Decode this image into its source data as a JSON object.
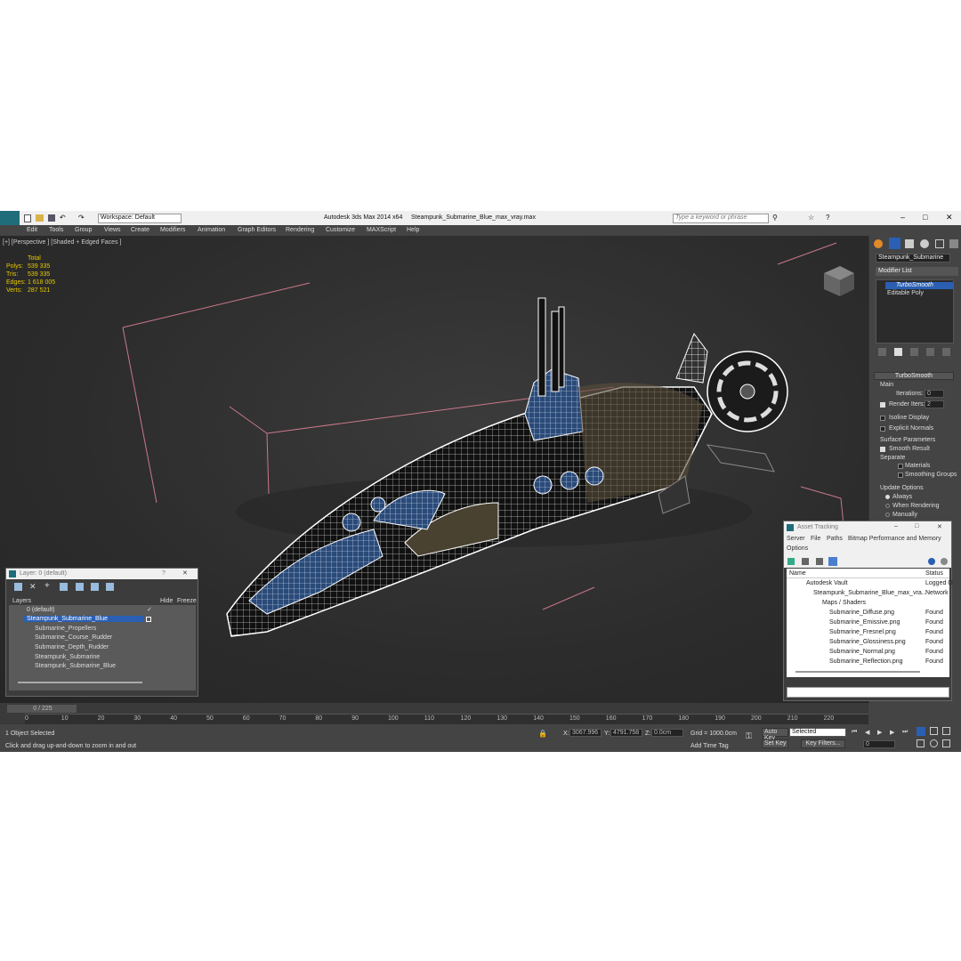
{
  "title": {
    "app": "Autodesk 3ds Max  2014 x64",
    "file": "Steampunk_Submarine_Blue_max_vray.max",
    "workspace": "Workspace: Default",
    "search_placeholder": "Type a keyword or phrase"
  },
  "menu": [
    "Edit",
    "Tools",
    "Group",
    "Views",
    "Create",
    "Modifiers",
    "Animation",
    "Graph Editors",
    "Rendering",
    "Customize",
    "MAXScript",
    "Help"
  ],
  "viewport": {
    "label": "[+] [Perspective ] [Shaded + Edged Faces ]",
    "stats": {
      "header": "Total",
      "rows": [
        {
          "k": "Polys:",
          "v": "539 335"
        },
        {
          "k": "Tris:",
          "v": "539 335"
        },
        {
          "k": "Edges:",
          "v": "1 618 005"
        },
        {
          "k": "Verts:",
          "v": "287 521"
        }
      ]
    }
  },
  "command_panel": {
    "object_name": "Steampunk_Submarine",
    "modifier_list": "Modifier List",
    "stack": [
      "TurboSmooth",
      "Editable Poly"
    ],
    "rollout": "TurboSmooth",
    "main": "Main",
    "iterations_label": "Iterations:",
    "iterations": "0",
    "render_iters_label": "Render Iters:",
    "render_iters": "2",
    "isoline": "Isoline Display",
    "explicit": "Explicit Normals",
    "surface": "Surface Parameters",
    "smooth": "Smooth Result",
    "separate": "Separate",
    "materials": "Materials",
    "smoothing": "Smoothing Groups",
    "update": "Update Options",
    "always": "Always",
    "when_rendering": "When Rendering",
    "manually": "Manually"
  },
  "layers": {
    "title": "Layer: 0 (default)",
    "help": "?",
    "col_layers": "Layers",
    "col_hide": "Hide",
    "col_freeze": "Freeze",
    "rows": [
      {
        "name": "0 (default)",
        "indent": 0,
        "selected": false
      },
      {
        "name": "Steampunk_Submarine_Blue",
        "indent": 0,
        "selected": true
      },
      {
        "name": "Submarine_Propellers",
        "indent": 1,
        "selected": false
      },
      {
        "name": "Submarine_Course_Rudder",
        "indent": 1,
        "selected": false
      },
      {
        "name": "Submarine_Depth_Rudder",
        "indent": 1,
        "selected": false
      },
      {
        "name": "Steampunk_Submarine",
        "indent": 1,
        "selected": false
      },
      {
        "name": "Steampunk_Submarine_Blue",
        "indent": 1,
        "selected": false
      }
    ]
  },
  "asset_tracking": {
    "title": "Asset Tracking",
    "menu": [
      "Server",
      "File",
      "Paths",
      "Bitmap Performance and Memory"
    ],
    "options": "Options",
    "col_name": "Name",
    "col_status": "Status",
    "rows": [
      {
        "name": "Autodesk Vault",
        "status": "Logged O",
        "indent": 0
      },
      {
        "name": "Steampunk_Submarine_Blue_max_vra...",
        "status": "Network",
        "indent": 1
      },
      {
        "name": "Maps / Shaders",
        "status": "",
        "indent": 2
      },
      {
        "name": "Submarine_Diffuse.png",
        "status": "Found",
        "indent": 3
      },
      {
        "name": "Submarine_Emissive.png",
        "status": "Found",
        "indent": 3
      },
      {
        "name": "Submarine_Fresnel.png",
        "status": "Found",
        "indent": 3
      },
      {
        "name": "Submarine_Glossiness.png",
        "status": "Found",
        "indent": 3
      },
      {
        "name": "Submarine_Normal.png",
        "status": "Found",
        "indent": 3
      },
      {
        "name": "Submarine_Reflection.png",
        "status": "Found",
        "indent": 3
      }
    ]
  },
  "timeline": {
    "frame": "0 / 225",
    "ticks": [
      "0",
      "10",
      "20",
      "30",
      "40",
      "50",
      "60",
      "70",
      "80",
      "90",
      "100",
      "110",
      "120",
      "130",
      "140",
      "150",
      "160",
      "170",
      "180",
      "190",
      "200",
      "210",
      "220"
    ]
  },
  "status": {
    "selected": "1 Object Selected",
    "prompt": "Click and drag up-and-down to zoom in and out",
    "x_label": "X:",
    "x": "3067.996",
    "y_label": "Y:",
    "y": "4791.758",
    "z_label": "Z:",
    "z": "0.0cm",
    "grid": "Grid = 1000.0cm",
    "add_time_tag": "Add Time Tag",
    "auto_key": "Auto Key",
    "set_key": "Set Key",
    "selected_dd": "Selected",
    "key_filters": "Key Filters...",
    "frame": "0"
  }
}
